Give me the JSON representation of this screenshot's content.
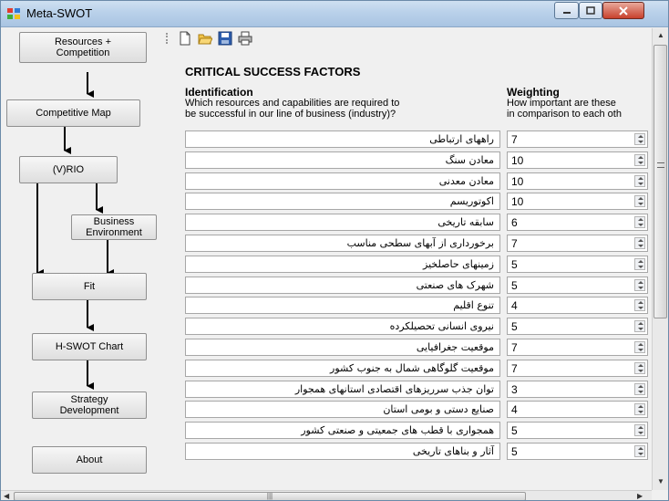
{
  "window": {
    "title": "Meta-SWOT",
    "controls": [
      "minimize-icon",
      "maximize-icon",
      "close-icon"
    ]
  },
  "nav": {
    "buttons": [
      "Resources +\nCompetition",
      "Competitive Map",
      "(V)RIO",
      "Business\nEnvironment",
      "Fit",
      "H-SWOT Chart",
      "Strategy\nDevelopment",
      "About"
    ]
  },
  "toolbar": {
    "icons": [
      "new-icon",
      "open-icon",
      "save-icon",
      "print-icon"
    ]
  },
  "main": {
    "heading": "CRITICAL SUCCESS FACTORS",
    "identification": {
      "title": "Identification",
      "description": "Which resources and capabilities are required to\nbe successful in our line of business (industry)?"
    },
    "weighting": {
      "title": "Weighting",
      "description": "How important are these\nin comparison to each oth"
    },
    "rows": [
      {
        "name": "راههای ارتباطی",
        "weight": "7"
      },
      {
        "name": "معادن سنگ",
        "weight": "10"
      },
      {
        "name": "معادن معدنی",
        "weight": "10"
      },
      {
        "name": "اکوتوریسم",
        "weight": "10"
      },
      {
        "name": "سابقه تاریخی",
        "weight": "6"
      },
      {
        "name": "برخورداری از آبهای سطحی مناسب",
        "weight": "7"
      },
      {
        "name": "زمینهای حاصلخیز",
        "weight": "5"
      },
      {
        "name": "شهرک های صنعتی",
        "weight": "5"
      },
      {
        "name": "تنوع اقلیم",
        "weight": "4"
      },
      {
        "name": "نیروی انسانی تحصیلکرده",
        "weight": "5"
      },
      {
        "name": "موقعیت جغرافیایی",
        "weight": "7"
      },
      {
        "name": "موقعیت گلوگاهی شمال به جنوب کشور",
        "weight": "7"
      },
      {
        "name": "توان جذب سرریزهای اقتصادی استانهای همجوار",
        "weight": "3"
      },
      {
        "name": "صنایع دستی و بومی استان",
        "weight": "4"
      },
      {
        "name": "همجواری با قطب های جمعیتی و صنعتی کشور",
        "weight": "5"
      },
      {
        "name": "آثار و بناهای تاریخی",
        "weight": "5"
      }
    ]
  },
  "scrollbar": {
    "h_grip": "|||"
  },
  "colors": {
    "titlebar": "#b9d1ea",
    "close": "#c8402c",
    "panel": "#f0f0f0"
  }
}
